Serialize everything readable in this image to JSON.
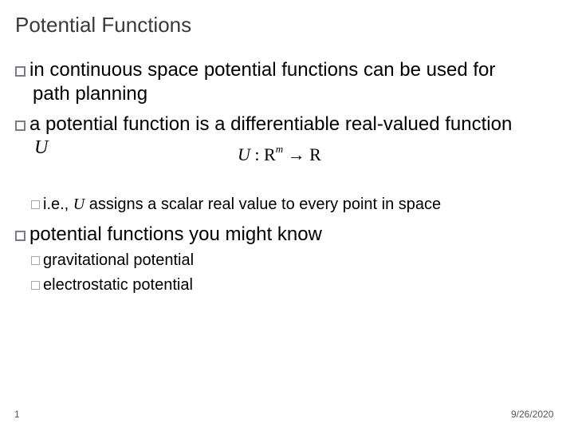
{
  "slide": {
    "title": "Potential Functions",
    "bullets": [
      {
        "line1": "in continuous space potential functions can be used for",
        "line2": "path planning"
      },
      {
        "line1": "a potential function is a differentiable real-valued function",
        "line2": "U"
      }
    ],
    "formula": {
      "lhs": "U",
      "colon": " : R",
      "sup": "m",
      "arrow": " → R"
    },
    "sub_bullet_ie": {
      "prefix": "i.e., ",
      "var": "U",
      "suffix": " assigns a scalar real value to every point in space"
    },
    "bullet3": "potential functions you might know",
    "sub_bullets": [
      "gravitational potential",
      "electrostatic potential"
    ]
  },
  "footer": {
    "slide_number": "1",
    "date": "9/26/2020"
  }
}
